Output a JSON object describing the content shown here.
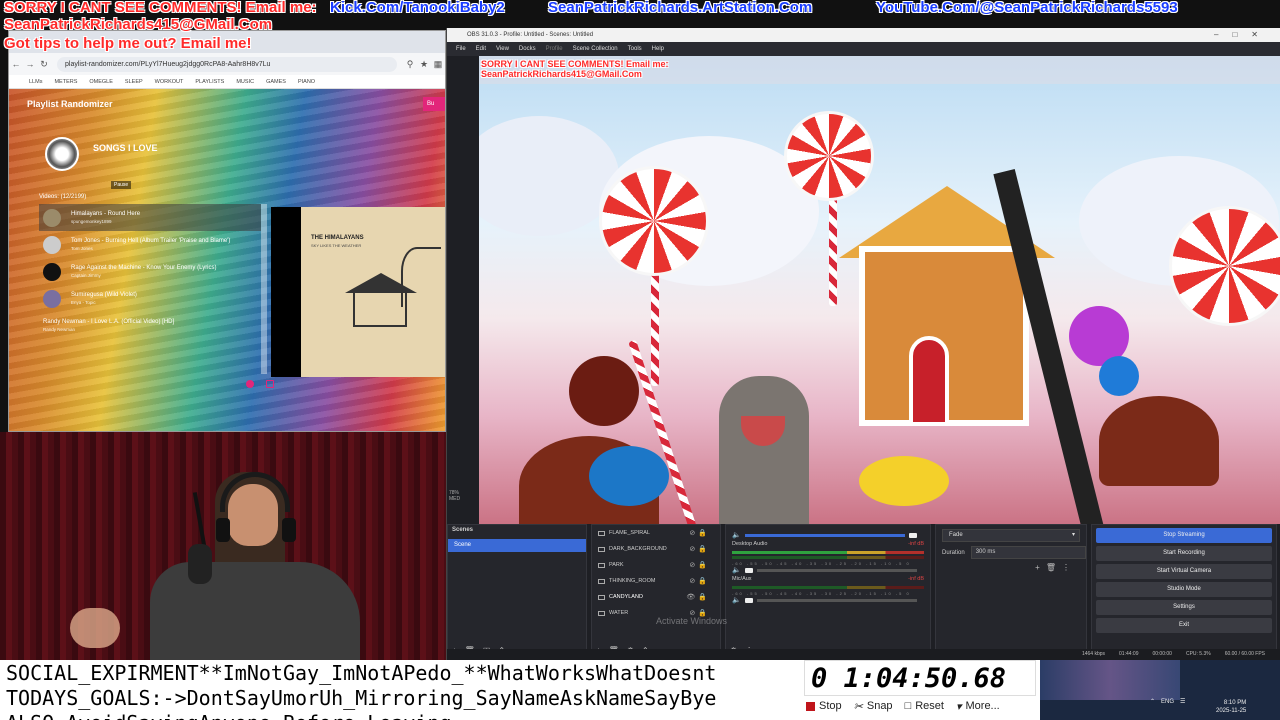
{
  "overlay": {
    "sorry": "SORRY I CANT SEE COMMENTS! Email me:",
    "email": "SeanPatrickRichards415@GMail.Com",
    "tips": "Got tips to help me out? Email me!",
    "kick": "Kick.Com/TanookiBaby2",
    "artstation": "SeanPatrickRichards.ArtStation.Com",
    "youtube": "YouTube.Com/@SeanPatrickRichards5593"
  },
  "browser": {
    "url": "playlist-randomizer.com/PLyYl7Hueug2jdgg0RcPA8-Aahr8H8v7Lu",
    "bookmarks": [
      "LLMs",
      "METERS",
      "OMEGLE",
      "SLEEP",
      "WORKOUT",
      "PLAYLISTS",
      "MUSIC",
      "GAMES",
      "PIANO"
    ],
    "app_title": "Playlist Randomizer",
    "buy_label": "Bu",
    "playlist_name": "SONGS I LOVE",
    "pause_label": "Pause",
    "videos_count": "Videos: (12/2199)",
    "songs": [
      {
        "title": "Himalayans - Round Here",
        "channel": "spungemonkey1899"
      },
      {
        "title": "Tom Jones - Burning Hell (Album Trailer 'Praise and Blame')",
        "channel": "Tom Jones"
      },
      {
        "title": "Rage Against the Machine - Know Your Enemy (Lyrics)",
        "channel": "Captain.Jimmy"
      },
      {
        "title": "Sumiregusa (Wild Violet)",
        "channel": "Enya - Topic"
      },
      {
        "title": "Randy Newman - I Love L.A. (Official Video) [HD]",
        "channel": "Randy Newman"
      }
    ],
    "album_title": "THE HIMALAYANS",
    "album_sub": "SKY LIKES THE WEATHER"
  },
  "obs": {
    "window_title": "OBS 31.0.3 - Profile: Untitled - Scenes: Untitled",
    "menu": [
      "File",
      "Edit",
      "View",
      "Docks",
      "Profile",
      "Scene Collection",
      "Tools",
      "Help"
    ],
    "scenes_title": "Scenes",
    "scenes": [
      "Scene"
    ],
    "sources": [
      "FLAME_SPIRAL",
      "DARK_BACKGROUND",
      "PARK",
      "THINKING_ROOM",
      "CANDYLAND",
      "WATER"
    ],
    "mixer": [
      {
        "name": "Desktop Audio",
        "db": "-inf dB"
      },
      {
        "name": "Mic/Aux",
        "db": "-inf dB"
      }
    ],
    "mixer_ticks": "-60 -55 -50 -45 -40 -35 -30 -25 -20 -15 -10 -5 0",
    "transition": "Fade",
    "duration_label": "Duration",
    "duration_value": "300 ms",
    "controls": [
      "Stop Streaming",
      "Start Recording",
      "Start Virtual Camera",
      "Studio Mode",
      "Settings",
      "Exit"
    ],
    "status": {
      "bitrate": "1464 kbps",
      "live_time": "01:44:09",
      "rec_time": "00:00:00",
      "cpu": "CPU: 5.3%",
      "fps": "60.00 / 60.00 FPS"
    },
    "watermark": "Activate Windows",
    "zoom": "78%",
    "mini_label": "MED"
  },
  "bottom": {
    "line1": "SOCIAL_EXPIRMENT**ImNotGay_ImNotAPedo_**WhatWorksWhatDoesnt",
    "line2": "TODAYS_GOALS:->DontSayUmorUh_Mirroring_SayNameAskNameSayBye",
    "line3": "ALSO-AvoidSayingAnyone_Before_Leaving",
    "timer": "0 1:04:50.68",
    "stopwatch": [
      "Stop",
      "Snap",
      "Reset",
      "More..."
    ]
  },
  "taskbar": {
    "lang": "ENG",
    "time": "8:10 PM",
    "date": "2025-11-25"
  }
}
